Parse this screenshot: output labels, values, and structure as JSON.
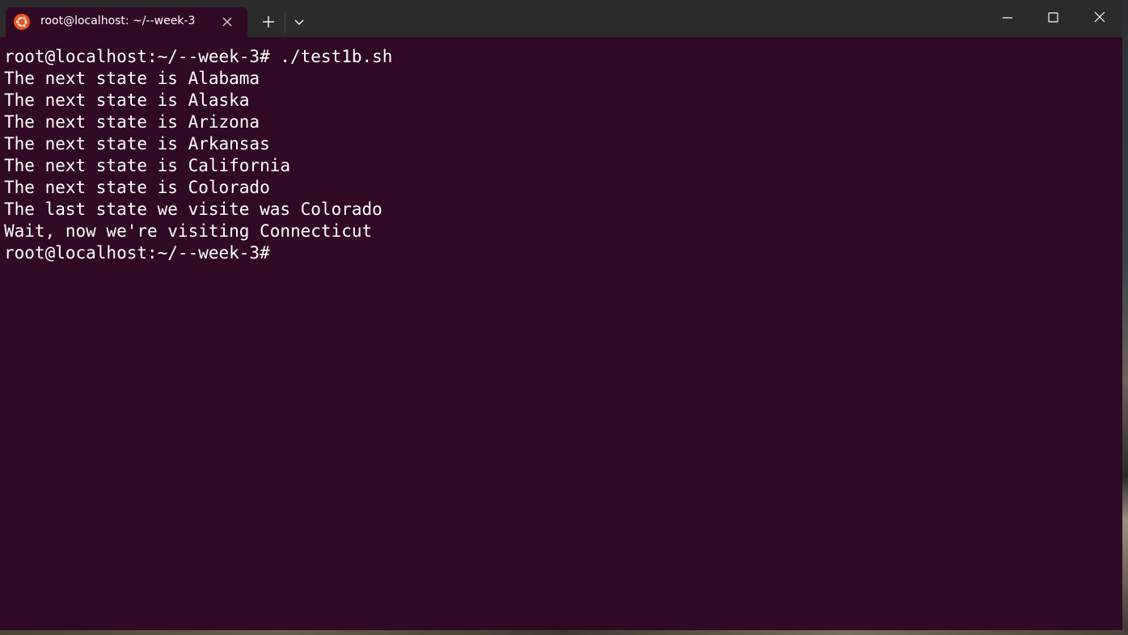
{
  "window": {
    "tab_title": "root@localhost: ~/--week-3",
    "tab_icon": "ubuntu-icon",
    "new_tab_icon": "plus-icon",
    "dropdown_icon": "chevron-down-icon",
    "controls": [
      "minimize-icon",
      "maximize-icon",
      "close-icon"
    ]
  },
  "colors": {
    "terminal_background": "#300a24",
    "titlebar_background": "#2b2b2b",
    "text": "#ffffff",
    "ubuntu_orange": "#e95420"
  },
  "terminal": {
    "lines": [
      "root@localhost:~/--week-3# ./test1b.sh",
      "The next state is Alabama",
      "The next state is Alaska",
      "The next state is Arizona",
      "The next state is Arkansas",
      "The next state is California",
      "The next state is Colorado",
      "The last state we visite was Colorado",
      "Wait, now we're visiting Connecticut",
      "root@localhost:~/--week-3#"
    ]
  }
}
